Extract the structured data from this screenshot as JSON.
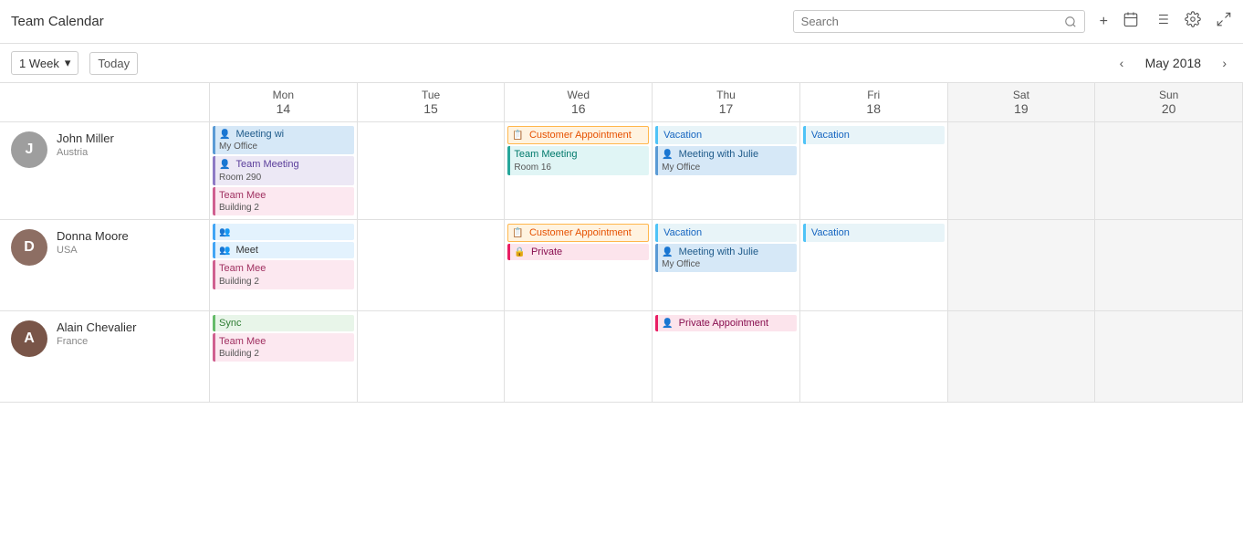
{
  "header": {
    "title": "Team Calendar",
    "search_placeholder": "Search",
    "icons": [
      "plus",
      "calendar-add",
      "list",
      "settings",
      "expand"
    ]
  },
  "toolbar": {
    "view_label": "1 Week",
    "today_label": "Today",
    "nav_prev": "‹",
    "nav_next": "›",
    "month_title": "May 2018"
  },
  "days": [
    {
      "name": "Mon",
      "num": "14",
      "weekend": false
    },
    {
      "name": "Tue",
      "num": "15",
      "weekend": false
    },
    {
      "name": "Wed",
      "num": "16",
      "weekend": false
    },
    {
      "name": "Thu",
      "num": "17",
      "weekend": false
    },
    {
      "name": "Fri",
      "num": "18",
      "weekend": false
    },
    {
      "name": "Sat",
      "num": "19",
      "weekend": true
    },
    {
      "name": "Sun",
      "num": "20",
      "weekend": true
    }
  ],
  "people": [
    {
      "name": "John Miller",
      "country": "Austria",
      "avatar_letter": "J",
      "avatar_color": "#9e9e9e",
      "events": {
        "mon": [
          {
            "title": "Meeting wi",
            "subtitle": "My Office",
            "color": "blue",
            "icon": "person"
          },
          {
            "title": "Team Meeting",
            "subtitle": "Room 290",
            "color": "purple",
            "icon": "person"
          },
          {
            "title": "Team Mee",
            "subtitle": "Building 2",
            "color": "pink",
            "icon": ""
          }
        ],
        "tue": [],
        "wed": [
          {
            "title": "Customer Appointment",
            "subtitle": "",
            "color": "customer",
            "icon": "calendar"
          },
          {
            "title": "Team Meeting",
            "subtitle": "Room 16",
            "color": "teal",
            "icon": ""
          }
        ],
        "thu": [
          {
            "title": "Vacation",
            "subtitle": "",
            "color": "vacation",
            "icon": ""
          },
          {
            "title": "Meeting with Julie",
            "subtitle": "My Office",
            "color": "blue",
            "icon": "person"
          }
        ],
        "fri": [
          {
            "title": "Vacation",
            "subtitle": "",
            "color": "vacation",
            "icon": ""
          }
        ],
        "sat": [],
        "sun": []
      }
    },
    {
      "name": "Donna Moore",
      "country": "USA",
      "avatar_letter": "D",
      "avatar_color": "#8d6e63",
      "events": {
        "mon": [
          {
            "title": "",
            "subtitle": "",
            "color": "group",
            "icon": "group"
          },
          {
            "title": "Meet",
            "subtitle": "",
            "color": "group",
            "icon": "group"
          },
          {
            "title": "Team Mee",
            "subtitle": "Building 2",
            "color": "pink",
            "icon": ""
          }
        ],
        "tue": [],
        "wed": [
          {
            "title": "Customer Appointment",
            "subtitle": "",
            "color": "customer",
            "icon": "calendar"
          },
          {
            "title": "Private",
            "subtitle": "",
            "color": "private-pink",
            "icon": "lock"
          }
        ],
        "thu": [
          {
            "title": "Vacation",
            "subtitle": "",
            "color": "vacation",
            "icon": ""
          },
          {
            "title": "Meeting with Julie",
            "subtitle": "My Office",
            "color": "blue",
            "icon": "person"
          }
        ],
        "fri": [
          {
            "title": "Vacation",
            "subtitle": "",
            "color": "vacation",
            "icon": ""
          }
        ],
        "sat": [],
        "sun": []
      }
    },
    {
      "name": "Alain Chevalier",
      "country": "France",
      "avatar_letter": "A",
      "avatar_color": "#795548",
      "events": {
        "mon": [
          {
            "title": "Sync",
            "subtitle": "",
            "color": "sync",
            "icon": ""
          },
          {
            "title": "Team Mee",
            "subtitle": "Building 2",
            "color": "pink",
            "icon": ""
          }
        ],
        "tue": [],
        "wed": [],
        "thu": [
          {
            "title": "Private Appointment",
            "subtitle": "",
            "color": "private-pink",
            "icon": "person"
          }
        ],
        "fri": [],
        "sat": [],
        "sun": []
      }
    }
  ]
}
